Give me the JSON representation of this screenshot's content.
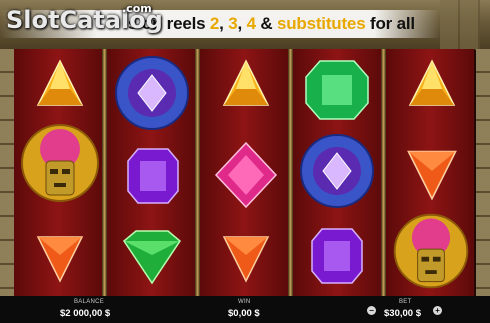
{
  "banner": {
    "prefix": "s on reels",
    "n2": "2",
    "c1": ",",
    "n3": "3",
    "c2": ",",
    "n4": "4",
    "amp": "&",
    "word": "substitutes",
    "suffix": "for all"
  },
  "watermark": {
    "text": "SlotCatalog",
    "com": ".com"
  },
  "reels": [
    [
      "yellow-triangle-gem",
      "aztec-sun-mask",
      "orange-triangle-gem"
    ],
    [
      "blue-flower-medallion",
      "purple-rectangle-gem",
      "green-heart-gem"
    ],
    [
      "yellow-triangle-gem",
      "pink-diamond-gem",
      "orange-triangle-gem"
    ],
    [
      "green-octagon-gem",
      "blue-flower-medallion",
      "purple-rectangle-gem"
    ],
    [
      "yellow-triangle-gem",
      "orange-triangle-gem",
      "aztec-sun-mask"
    ]
  ],
  "bottom": {
    "balance_label": "BALANCE",
    "balance_value": "$2 000,00 $",
    "win_label": "WIN",
    "win_value": "$0,00 $",
    "bet_label": "BET",
    "bet_value": "$30,00 $",
    "minus": "−",
    "plus": "+"
  },
  "colors": {
    "reel": "#8e1414",
    "highlight": "#e8a800",
    "bar": "#0b0b0b"
  }
}
